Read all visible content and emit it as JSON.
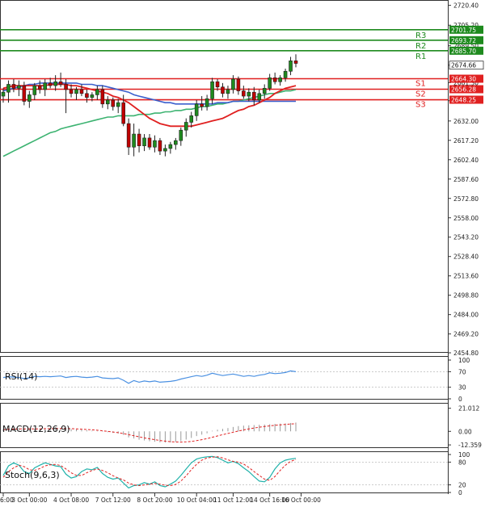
{
  "chart_data": {
    "type": "candlestick",
    "price_panel": {
      "y_ticks": [
        "2720.40",
        "2705.20",
        "2689.50",
        "2674.66",
        "2661.30",
        "2647.50",
        "2632.00",
        "2617.20",
        "2602.40",
        "2587.60",
        "2572.80",
        "2558.00",
        "2543.20",
        "2528.40",
        "2513.60",
        "2498.80",
        "2484.00",
        "2469.20",
        "2454.80"
      ],
      "y_tick_values": [
        2720.4,
        2705.2,
        2689.5,
        2674.66,
        2661.3,
        2647.5,
        2632.0,
        2617.2,
        2602.4,
        2587.6,
        2572.8,
        2558.0,
        2543.2,
        2528.4,
        2513.6,
        2498.8,
        2484.0,
        2469.2,
        2454.8
      ],
      "ylim": [
        2454.8,
        2722.0
      ],
      "current_price": "2674.66",
      "levels": [
        {
          "name": "R3",
          "value": 2701.75,
          "label": "2701.75",
          "color": "#1e8a1e"
        },
        {
          "name": "R2",
          "value": 2693.72,
          "label": "2693.72",
          "color": "#1e8a1e"
        },
        {
          "name": "R1",
          "value": 2685.7,
          "label": "2685.70",
          "color": "#1e8a1e"
        },
        {
          "name": "S1",
          "value": 2664.3,
          "label": "2664.30",
          "color": "#e02020"
        },
        {
          "name": "S2",
          "value": 2656.28,
          "label": "2656.28",
          "color": "#e02020"
        },
        {
          "name": "S3",
          "value": 2648.25,
          "label": "2648.25",
          "color": "#e02020"
        }
      ],
      "candles": [
        {
          "o": 2651.0,
          "h": 2657.0,
          "l": 2646.0,
          "c": 2654.0
        },
        {
          "o": 2654.0,
          "h": 2663.0,
          "l": 2646.0,
          "c": 2660.0
        },
        {
          "o": 2660.0,
          "h": 2664.0,
          "l": 2654.0,
          "c": 2657.0
        },
        {
          "o": 2657.0,
          "h": 2663.0,
          "l": 2651.0,
          "c": 2659.0
        },
        {
          "o": 2659.0,
          "h": 2662.0,
          "l": 2644.0,
          "c": 2647.0
        },
        {
          "o": 2647.0,
          "h": 2655.0,
          "l": 2642.0,
          "c": 2652.0
        },
        {
          "o": 2652.0,
          "h": 2661.0,
          "l": 2648.0,
          "c": 2659.0
        },
        {
          "o": 2659.0,
          "h": 2663.0,
          "l": 2653.0,
          "c": 2656.0
        },
        {
          "o": 2656.0,
          "h": 2664.0,
          "l": 2651.0,
          "c": 2661.0
        },
        {
          "o": 2661.0,
          "h": 2665.0,
          "l": 2657.0,
          "c": 2659.0
        },
        {
          "o": 2659.0,
          "h": 2667.0,
          "l": 2655.0,
          "c": 2662.0
        },
        {
          "o": 2662.0,
          "h": 2669.0,
          "l": 2658.0,
          "c": 2660.0
        },
        {
          "o": 2660.0,
          "h": 2664.0,
          "l": 2638.0,
          "c": 2656.0
        },
        {
          "o": 2656.0,
          "h": 2660.0,
          "l": 2650.0,
          "c": 2653.0
        },
        {
          "o": 2653.0,
          "h": 2658.0,
          "l": 2648.0,
          "c": 2656.0
        },
        {
          "o": 2656.0,
          "h": 2660.0,
          "l": 2651.0,
          "c": 2653.0
        },
        {
          "o": 2653.0,
          "h": 2656.0,
          "l": 2646.0,
          "c": 2650.0
        },
        {
          "o": 2650.0,
          "h": 2654.0,
          "l": 2647.0,
          "c": 2652.0
        },
        {
          "o": 2652.0,
          "h": 2659.0,
          "l": 2648.0,
          "c": 2656.0
        },
        {
          "o": 2656.0,
          "h": 2659.0,
          "l": 2642.0,
          "c": 2645.0
        },
        {
          "o": 2645.0,
          "h": 2651.0,
          "l": 2641.0,
          "c": 2648.0
        },
        {
          "o": 2648.0,
          "h": 2650.0,
          "l": 2640.0,
          "c": 2643.0
        },
        {
          "o": 2643.0,
          "h": 2649.0,
          "l": 2638.0,
          "c": 2646.0
        },
        {
          "o": 2646.0,
          "h": 2652.0,
          "l": 2628.0,
          "c": 2630.0
        },
        {
          "o": 2630.0,
          "h": 2634.0,
          "l": 2606.0,
          "c": 2612.0
        },
        {
          "o": 2612.0,
          "h": 2630.0,
          "l": 2605.0,
          "c": 2622.0
        },
        {
          "o": 2622.0,
          "h": 2626.0,
          "l": 2608.0,
          "c": 2613.0
        },
        {
          "o": 2613.0,
          "h": 2622.0,
          "l": 2609.0,
          "c": 2619.0
        },
        {
          "o": 2619.0,
          "h": 2622.0,
          "l": 2610.0,
          "c": 2612.0
        },
        {
          "o": 2612.0,
          "h": 2621.0,
          "l": 2608.0,
          "c": 2617.0
        },
        {
          "o": 2617.0,
          "h": 2619.0,
          "l": 2606.0,
          "c": 2609.0
        },
        {
          "o": 2609.0,
          "h": 2614.0,
          "l": 2605.0,
          "c": 2611.0
        },
        {
          "o": 2611.0,
          "h": 2616.0,
          "l": 2607.0,
          "c": 2614.0
        },
        {
          "o": 2614.0,
          "h": 2619.0,
          "l": 2610.0,
          "c": 2617.0
        },
        {
          "o": 2617.0,
          "h": 2627.0,
          "l": 2613.0,
          "c": 2625.0
        },
        {
          "o": 2625.0,
          "h": 2634.0,
          "l": 2620.0,
          "c": 2631.0
        },
        {
          "o": 2631.0,
          "h": 2639.0,
          "l": 2627.0,
          "c": 2636.0
        },
        {
          "o": 2636.0,
          "h": 2648.0,
          "l": 2632.0,
          "c": 2645.0
        },
        {
          "o": 2645.0,
          "h": 2651.0,
          "l": 2640.0,
          "c": 2643.0
        },
        {
          "o": 2643.0,
          "h": 2652.0,
          "l": 2640.0,
          "c": 2649.0
        },
        {
          "o": 2649.0,
          "h": 2665.0,
          "l": 2645.0,
          "c": 2662.0
        },
        {
          "o": 2662.0,
          "h": 2664.0,
          "l": 2655.0,
          "c": 2658.0
        },
        {
          "o": 2658.0,
          "h": 2661.0,
          "l": 2650.0,
          "c": 2653.0
        },
        {
          "o": 2653.0,
          "h": 2659.0,
          "l": 2649.0,
          "c": 2656.0
        },
        {
          "o": 2656.0,
          "h": 2667.0,
          "l": 2653.0,
          "c": 2664.0
        },
        {
          "o": 2664.0,
          "h": 2666.0,
          "l": 2652.0,
          "c": 2655.0
        },
        {
          "o": 2655.0,
          "h": 2659.0,
          "l": 2649.0,
          "c": 2651.0
        },
        {
          "o": 2651.0,
          "h": 2657.0,
          "l": 2647.0,
          "c": 2654.0
        },
        {
          "o": 2654.0,
          "h": 2658.0,
          "l": 2644.0,
          "c": 2648.0
        },
        {
          "o": 2648.0,
          "h": 2656.0,
          "l": 2646.0,
          "c": 2653.0
        },
        {
          "o": 2653.0,
          "h": 2660.0,
          "l": 2649.0,
          "c": 2657.0
        },
        {
          "o": 2657.0,
          "h": 2668.0,
          "l": 2655.0,
          "c": 2665.0
        },
        {
          "o": 2665.0,
          "h": 2669.0,
          "l": 2660.0,
          "c": 2662.0
        },
        {
          "o": 2662.0,
          "h": 2667.0,
          "l": 2659.0,
          "c": 2665.0
        },
        {
          "o": 2665.0,
          "h": 2672.0,
          "l": 2662.0,
          "c": 2670.0
        },
        {
          "o": 2670.0,
          "h": 2681.0,
          "l": 2667.0,
          "c": 2678.0
        },
        {
          "o": 2678.0,
          "h": 2683.0,
          "l": 2673.0,
          "c": 2676.0
        }
      ],
      "ma_fast_red": [
        2657,
        2658,
        2659,
        2659,
        2659,
        2659,
        2659,
        2659,
        2659,
        2660,
        2660,
        2660,
        2660,
        2659,
        2659,
        2658,
        2657,
        2656,
        2655,
        2654,
        2653,
        2651,
        2650,
        2648,
        2646,
        2643,
        2640,
        2637,
        2634,
        2632,
        2630,
        2629,
        2628,
        2628,
        2628,
        2628,
        2628,
        2629,
        2630,
        2631,
        2632,
        2633,
        2634,
        2636,
        2638,
        2640,
        2641,
        2643,
        2644,
        2646,
        2648,
        2650,
        2653,
        2655,
        2657,
        2658,
        2659
      ],
      "ma_mid_blue": [
        2655,
        2656,
        2657,
        2658,
        2659,
        2660,
        2660,
        2661,
        2661,
        2661,
        2661,
        2661,
        2661,
        2661,
        2661,
        2660,
        2660,
        2660,
        2659,
        2659,
        2658,
        2657,
        2656,
        2655,
        2654,
        2652,
        2651,
        2650,
        2649,
        2648,
        2647,
        2646,
        2646,
        2645,
        2645,
        2645,
        2645,
        2645,
        2645,
        2645,
        2645,
        2646,
        2646,
        2646,
        2647,
        2647,
        2647,
        2647,
        2647,
        2647,
        2647,
        2647,
        2647,
        2647,
        2647,
        2647,
        2647
      ],
      "ma_slow_green": [
        2605,
        2607,
        2609,
        2611,
        2613,
        2615,
        2617,
        2619,
        2621,
        2623,
        2624,
        2626,
        2627,
        2628,
        2629,
        2630,
        2631,
        2632,
        2633,
        2634,
        2635,
        2635,
        2636,
        2636,
        2636,
        2636,
        2637,
        2637,
        2637,
        2638,
        2638,
        2639,
        2639,
        2640,
        2640,
        2641,
        2641,
        2642,
        2643,
        2643,
        2644,
        2645,
        2645,
        2646,
        2647,
        2647,
        2648,
        2649,
        2650,
        2651,
        2652,
        2653,
        2653,
        2654,
        2655,
        2655,
        2656
      ]
    },
    "x_ticks": [
      {
        "label": "6:00",
        "i": 0
      },
      {
        "label": "3 Oct 00:00",
        "i": 5
      },
      {
        "label": "4 Oct 08:00",
        "i": 13
      },
      {
        "label": "7 Oct 12:00",
        "i": 21
      },
      {
        "label": "8 Oct 20:00",
        "i": 29
      },
      {
        "label": "10 Oct 04:00",
        "i": 37
      },
      {
        "label": "11 Oct 12:00",
        "i": 44
      },
      {
        "label": "14 Oct 16:00",
        "i": 51
      },
      {
        "label": "16 Oct 00:00",
        "i": 57
      }
    ],
    "rsi_panel": {
      "label": "RSI(14)",
      "y_ticks": [
        "100",
        "70",
        "30",
        "0"
      ],
      "y_tick_values": [
        100,
        70,
        30,
        0
      ],
      "ylim": [
        0,
        100
      ],
      "values": [
        55,
        57,
        56,
        55,
        52,
        54,
        58,
        57,
        58,
        57,
        58,
        59,
        55,
        57,
        58,
        56,
        55,
        56,
        58,
        54,
        53,
        52,
        54,
        48,
        40,
        47,
        43,
        46,
        44,
        46,
        43,
        44,
        45,
        47,
        51,
        54,
        57,
        60,
        58,
        61,
        66,
        63,
        60,
        62,
        64,
        61,
        58,
        60,
        58,
        61,
        63,
        67,
        65,
        66,
        68,
        72,
        70
      ]
    },
    "macd_panel": {
      "label": "MACD(12,26,9)",
      "y_ticks": [
        "21.012",
        "0.00",
        "-12.359"
      ],
      "y_tick_values": [
        21.012,
        0.0,
        -12.359
      ],
      "ylim": [
        -14.5,
        23.0
      ],
      "hist": [
        2.0,
        2.5,
        2.8,
        3.0,
        2.6,
        2.3,
        2.4,
        2.5,
        2.7,
        2.8,
        2.9,
        3.0,
        2.4,
        2.0,
        1.8,
        1.5,
        1.0,
        0.6,
        0.4,
        -0.3,
        -0.8,
        -1.4,
        -2.0,
        -3.2,
        -5.5,
        -6.5,
        -7.6,
        -8.3,
        -9.0,
        -9.5,
        -10.0,
        -10.2,
        -10.1,
        -9.6,
        -8.8,
        -7.5,
        -6.0,
        -4.3,
        -3.0,
        -1.8,
        0.5,
        1.5,
        2.2,
        3.0,
        4.0,
        4.8,
        5.2,
        5.5,
        5.7,
        6.0,
        6.2,
        6.5,
        6.8,
        7.0,
        7.2,
        7.6,
        8.0
      ],
      "signal": [
        1.5,
        1.8,
        2.0,
        2.2,
        2.3,
        2.3,
        2.3,
        2.3,
        2.4,
        2.4,
        2.5,
        2.6,
        2.5,
        2.4,
        2.2,
        2.0,
        1.7,
        1.4,
        1.0,
        0.5,
        0.0,
        -0.6,
        -1.2,
        -2.0,
        -3.0,
        -4.0,
        -5.0,
        -6.0,
        -6.8,
        -7.6,
        -8.3,
        -8.9,
        -9.4,
        -9.7,
        -9.8,
        -9.6,
        -9.2,
        -8.5,
        -7.6,
        -6.6,
        -5.4,
        -4.2,
        -3.0,
        -1.9,
        -0.8,
        0.3,
        1.3,
        2.2,
        3.0,
        3.8,
        4.4,
        5.0,
        5.5,
        5.9,
        6.3,
        6.7,
        7.0
      ]
    },
    "stoch_panel": {
      "label": "Stoch(9,6,3)",
      "y_ticks": [
        "100",
        "80",
        "20",
        "0"
      ],
      "y_tick_values": [
        100,
        80,
        20,
        0
      ],
      "ylim": [
        0,
        100
      ],
      "k": [
        45,
        70,
        78,
        72,
        55,
        50,
        65,
        72,
        78,
        74,
        70,
        68,
        48,
        38,
        42,
        55,
        62,
        60,
        66,
        50,
        40,
        35,
        38,
        25,
        12,
        18,
        20,
        26,
        22,
        28,
        18,
        15,
        22,
        30,
        45,
        62,
        78,
        88,
        92,
        94,
        95,
        92,
        85,
        78,
        82,
        76,
        65,
        55,
        42,
        30,
        28,
        40,
        62,
        78,
        85,
        88,
        90
      ],
      "d": [
        40,
        55,
        65,
        72,
        68,
        60,
        58,
        63,
        70,
        73,
        74,
        71,
        62,
        52,
        45,
        45,
        52,
        58,
        62,
        58,
        52,
        44,
        38,
        33,
        25,
        20,
        18,
        20,
        22,
        24,
        22,
        19,
        18,
        21,
        30,
        44,
        60,
        74,
        85,
        91,
        93,
        94,
        91,
        86,
        82,
        80,
        75,
        66,
        55,
        45,
        35,
        32,
        42,
        58,
        72,
        82,
        87
      ]
    }
  }
}
